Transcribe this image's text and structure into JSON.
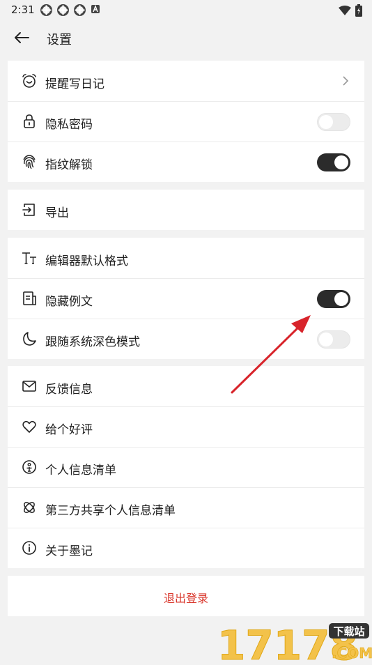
{
  "status_bar": {
    "time": "2:31",
    "notification_icons": [
      "sync-icon",
      "sync-icon",
      "sync-icon",
      "a-box-icon"
    ],
    "right_icons": [
      "wifi-icon",
      "battery-icon"
    ]
  },
  "header": {
    "back_icon": "arrow-left-icon",
    "title": "设置"
  },
  "groups": [
    {
      "items": [
        {
          "icon": "alarm-clock-icon",
          "label": "提醒写日记",
          "control": "chevron"
        },
        {
          "icon": "lock-icon",
          "label": "隐私密码",
          "control": "toggle",
          "on": false
        },
        {
          "icon": "fingerprint-icon",
          "label": "指纹解锁",
          "control": "toggle",
          "on": true
        }
      ]
    },
    {
      "items": [
        {
          "icon": "export-icon",
          "label": "导出"
        }
      ]
    },
    {
      "items": [
        {
          "icon": "text-format-icon",
          "label": "编辑器默认格式"
        },
        {
          "icon": "document-icon",
          "label": "隐藏例文",
          "control": "toggle",
          "on": true
        },
        {
          "icon": "moon-icon",
          "label": "跟随系统深色模式",
          "control": "toggle",
          "on": false
        }
      ]
    },
    {
      "items": [
        {
          "icon": "mail-icon",
          "label": "反馈信息"
        },
        {
          "icon": "heart-icon",
          "label": "给个好评"
        },
        {
          "icon": "person-info-icon",
          "label": "个人信息清单"
        },
        {
          "icon": "share-icon",
          "label": "第三方共享个人信息清单"
        },
        {
          "icon": "info-icon",
          "label": "关于墨记"
        }
      ]
    }
  ],
  "logout": {
    "label": "退出登录",
    "color": "#d9362b"
  },
  "colors": {
    "background": "#f2f2f2",
    "toggle_on": "#2b2b2b",
    "toggle_off": "#ececec",
    "annotation_arrow": "#d8242b"
  },
  "watermark": {
    "text": "17178",
    "badge": "下载站",
    "suffix": ".COM"
  }
}
